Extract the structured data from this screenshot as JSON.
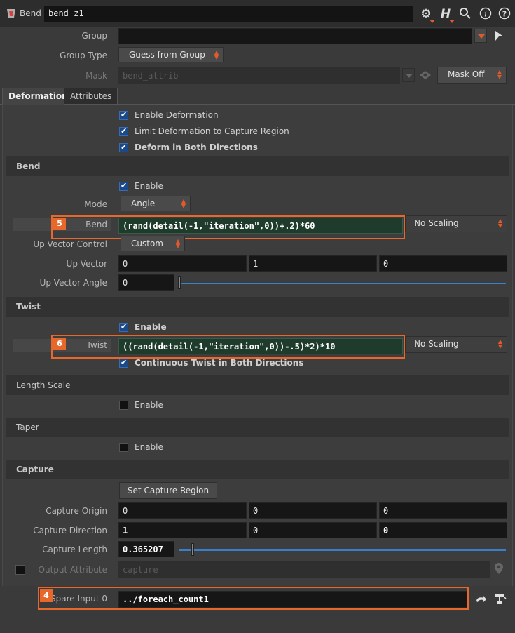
{
  "header": {
    "node_type": "Bend",
    "node_name": "bend_z1",
    "icons": [
      "gear-icon",
      "houdini-help-icon",
      "search-icon",
      "info-icon",
      "question-icon"
    ]
  },
  "top": {
    "group_label": "Group",
    "group_value": "",
    "group_type_label": "Group Type",
    "group_type_value": "Guess from Group",
    "mask_label": "Mask",
    "mask_value": "bend_attrib",
    "mask_mode": "Mask Off"
  },
  "tabs": [
    "Deformation",
    "Attributes"
  ],
  "deformation": {
    "enable_deformation": "Enable Deformation",
    "limit_deformation": "Limit Deformation to Capture Region",
    "deform_both": "Deform in Both Directions"
  },
  "bend": {
    "title": "Bend",
    "enable": "Enable",
    "mode_label": "Mode",
    "mode_value": "Angle",
    "bend_label": "Bend",
    "bend_expr": "(rand(detail(-1,\"iteration\",0))+.2)*60",
    "bend_scaling": "No Scaling",
    "up_vector_control_label": "Up Vector Control",
    "up_vector_control_value": "Custom",
    "up_vector_label": "Up Vector",
    "up_vector": [
      "0",
      "1",
      "0"
    ],
    "up_vector_angle_label": "Up Vector Angle",
    "up_vector_angle": "0",
    "highlight_num": "5"
  },
  "twist": {
    "title": "Twist",
    "enable": "Enable",
    "twist_label": "Twist",
    "twist_expr": "((rand(detail(-1,\"iteration\",0))-.5)*2)*10",
    "twist_scaling": "No Scaling",
    "continuous": "Continuous Twist in Both Directions",
    "highlight_num": "6"
  },
  "length_scale": {
    "title": "Length Scale",
    "enable": "Enable"
  },
  "taper": {
    "title": "Taper",
    "enable": "Enable"
  },
  "capture": {
    "title": "Capture",
    "set_region_button": "Set Capture Region",
    "origin_label": "Capture Origin",
    "origin": [
      "0",
      "0",
      "0"
    ],
    "direction_label": "Capture Direction",
    "direction": [
      "1",
      "0",
      "0"
    ],
    "length_label": "Capture Length",
    "length": "0.365207",
    "length_fraction": 0.04,
    "output_attr_label": "Output Attribute",
    "output_attr_value": "capture"
  },
  "spare": {
    "label": "Spare Input 0",
    "value": "../foreach_count1",
    "highlight_num": "4"
  },
  "colors": {
    "accent": "#e8672a",
    "checkbox_blue": "#1a4a8a",
    "expr_green": "#1f3b2c",
    "slider_blue": "#3a7fc9"
  }
}
